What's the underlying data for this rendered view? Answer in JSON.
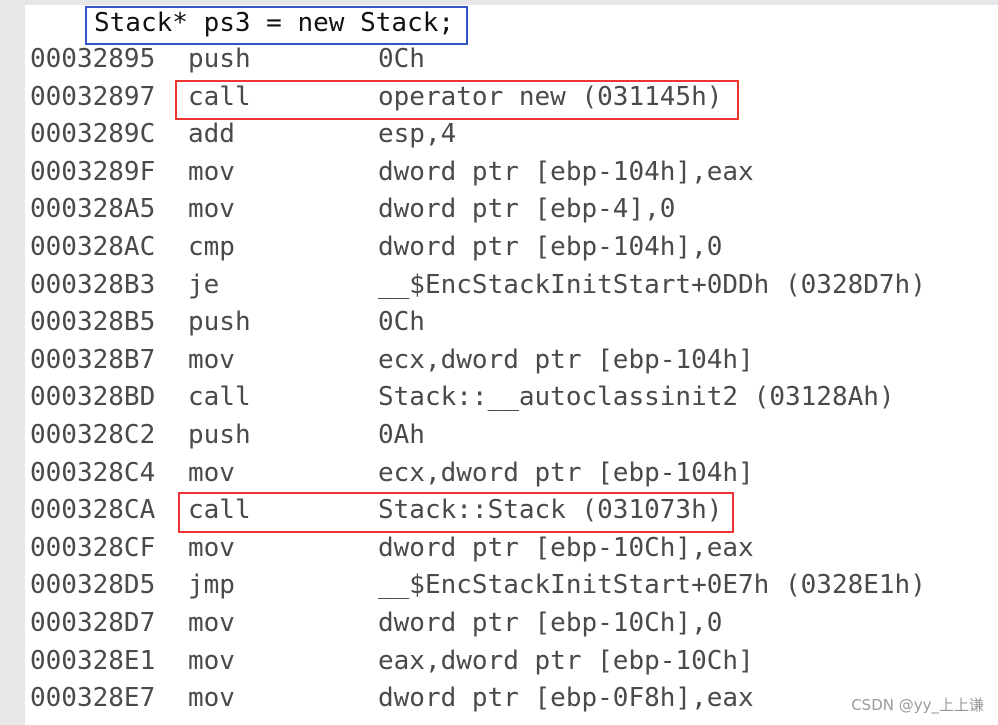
{
  "source_line": "Stack* ps3 = new Stack;",
  "rows": [
    {
      "addr": "00032895",
      "mn": "push",
      "op": "0Ch"
    },
    {
      "addr": "00032897",
      "mn": "call",
      "op": "operator new (031145h)"
    },
    {
      "addr": "0003289C",
      "mn": "add",
      "op": "esp,4"
    },
    {
      "addr": "0003289F",
      "mn": "mov",
      "op": "dword ptr [ebp-104h],eax"
    },
    {
      "addr": "000328A5",
      "mn": "mov",
      "op": "dword ptr [ebp-4],0"
    },
    {
      "addr": "000328AC",
      "mn": "cmp",
      "op": "dword ptr [ebp-104h],0"
    },
    {
      "addr": "000328B3",
      "mn": "je",
      "op": "__$EncStackInitStart+0DDh (0328D7h)"
    },
    {
      "addr": "000328B5",
      "mn": "push",
      "op": "0Ch"
    },
    {
      "addr": "000328B7",
      "mn": "mov",
      "op": "ecx,dword ptr [ebp-104h]"
    },
    {
      "addr": "000328BD",
      "mn": "call",
      "op": "Stack::__autoclassinit2 (03128Ah)"
    },
    {
      "addr": "000328C2",
      "mn": "push",
      "op": "0Ah"
    },
    {
      "addr": "000328C4",
      "mn": "mov",
      "op": "ecx,dword ptr [ebp-104h]"
    },
    {
      "addr": "000328CA",
      "mn": "call",
      "op": "Stack::Stack (031073h)"
    },
    {
      "addr": "000328CF",
      "mn": "mov",
      "op": "dword ptr [ebp-10Ch],eax"
    },
    {
      "addr": "000328D5",
      "mn": "jmp",
      "op": "__$EncStackInitStart+0E7h (0328E1h)"
    },
    {
      "addr": "000328D7",
      "mn": "mov",
      "op": "dword ptr [ebp-10Ch],0"
    },
    {
      "addr": "000328E1",
      "mn": "mov",
      "op": "eax,dword ptr [ebp-10Ch]"
    },
    {
      "addr": "000328E7",
      "mn": "mov",
      "op": "dword ptr [ebp-0F8h],eax"
    }
  ],
  "highlight_colors": {
    "source": "#3355cc",
    "calls": "#ee3333"
  },
  "watermark": "CSDN @yy_上上谦"
}
